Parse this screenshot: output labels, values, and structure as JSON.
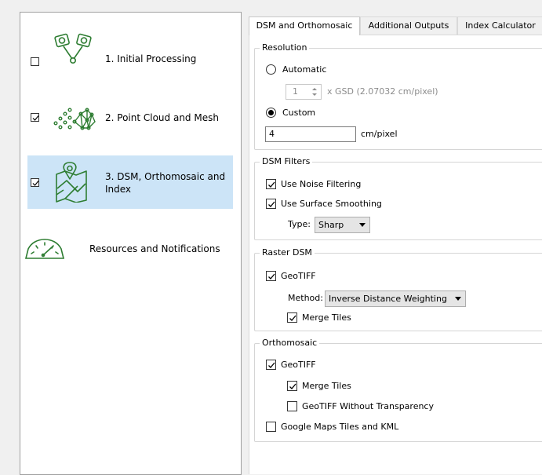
{
  "nav": {
    "items": [
      {
        "label": "1. Initial Processing",
        "checked": false,
        "icon": "initial-processing-icon"
      },
      {
        "label": "2. Point Cloud and Mesh",
        "checked": true,
        "icon": "point-cloud-icon"
      },
      {
        "label_line1": "3. DSM, Orthomosaic and",
        "label_line2": "Index",
        "checked": true,
        "selected": true,
        "icon": "map-icon"
      },
      {
        "label": "Resources and Notifications",
        "icon": "gauge-icon"
      }
    ],
    "accent_color": "#2e7d32",
    "selected_bg": "#cce4f7"
  },
  "tabs": [
    {
      "label": "DSM and Orthomosaic",
      "active": true
    },
    {
      "label": "Additional Outputs",
      "active": false
    },
    {
      "label": "Index Calculator",
      "active": false
    }
  ],
  "resolution": {
    "title": "Resolution",
    "automatic_label": "Automatic",
    "automatic_selected": false,
    "gsd_value": "1",
    "gsd_text": "x GSD (2.07032 cm/pixel)",
    "custom_label": "Custom",
    "custom_selected": true,
    "custom_value": "4",
    "custom_unit": "cm/pixel"
  },
  "dsm_filters": {
    "title": "DSM Filters",
    "noise_label": "Use Noise Filtering",
    "noise_checked": true,
    "smoothing_label": "Use Surface Smoothing",
    "smoothing_checked": true,
    "type_label": "Type:",
    "type_value": "Sharp"
  },
  "raster_dsm": {
    "title": "Raster DSM",
    "geotiff_label": "GeoTIFF",
    "geotiff_checked": true,
    "method_label": "Method:",
    "method_value": "Inverse Distance Weighting",
    "merge_label": "Merge Tiles",
    "merge_checked": true
  },
  "orthomosaic": {
    "title": "Orthomosaic",
    "geotiff_label": "GeoTIFF",
    "geotiff_checked": true,
    "merge_label": "Merge Tiles",
    "merge_checked": true,
    "no_transparency_label": "GeoTIFF Without Transparency",
    "no_transparency_checked": false,
    "gmaps_label": "Google Maps Tiles and KML",
    "gmaps_checked": false
  }
}
